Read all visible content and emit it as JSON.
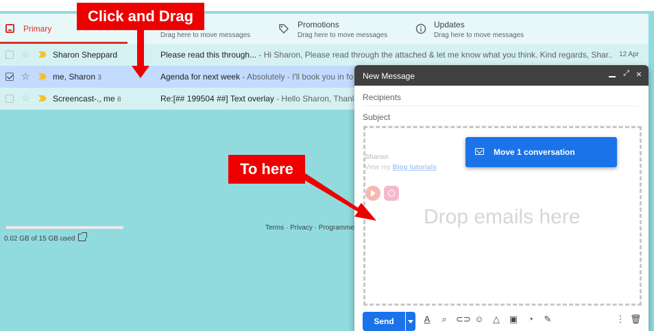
{
  "tabs": [
    {
      "name": "Primary",
      "sub": ""
    },
    {
      "name": "",
      "sub": "Drag here to move messages"
    },
    {
      "name": "Promotions",
      "sub": "Drag here to move messages"
    },
    {
      "name": "Updates",
      "sub": "Drag here to move messages"
    }
  ],
  "rows": [
    {
      "sender": "Sharon Sheppard",
      "count": "",
      "subject": "Please read this through...",
      "snippet": " - Hi Sharon, Please read through the attached & let me know what you think. Kind regards, Shar...",
      "date": "12 Apr"
    },
    {
      "sender": "me, Sharon",
      "count": "3",
      "subject": "Agenda for next week",
      "snippet": " - Absolutely - I'll book you in for th",
      "date": ""
    },
    {
      "sender": "Screencast-., me",
      "count": "8",
      "subject": "Re:[## 199504 ##] Text overlay",
      "snippet": " - Hello Sharon, Thank yo",
      "date": ""
    }
  ],
  "storage": {
    "text": "0.02 GB of 15 GB used",
    "fraction": 0.0013
  },
  "footer": {
    "links": "Terms · Privacy · Programme"
  },
  "compose": {
    "title": "New Message",
    "recipients_placeholder": "Recipients",
    "subject_placeholder": "Subject",
    "drop_text": "Drop emails here",
    "signature_name": "Sharon",
    "signature_prefix": "View my ",
    "signature_link": "Blog tutorials",
    "send_label": "Send"
  },
  "drag_card": {
    "label": "Move 1 conversation"
  },
  "annotations": {
    "callout1": "Click and Drag",
    "callout2": "To here"
  },
  "colors": {
    "accent": "#1a73e8",
    "primary_tab": "#d93025",
    "annotation": "#ee0000",
    "background": "#91dbde"
  }
}
